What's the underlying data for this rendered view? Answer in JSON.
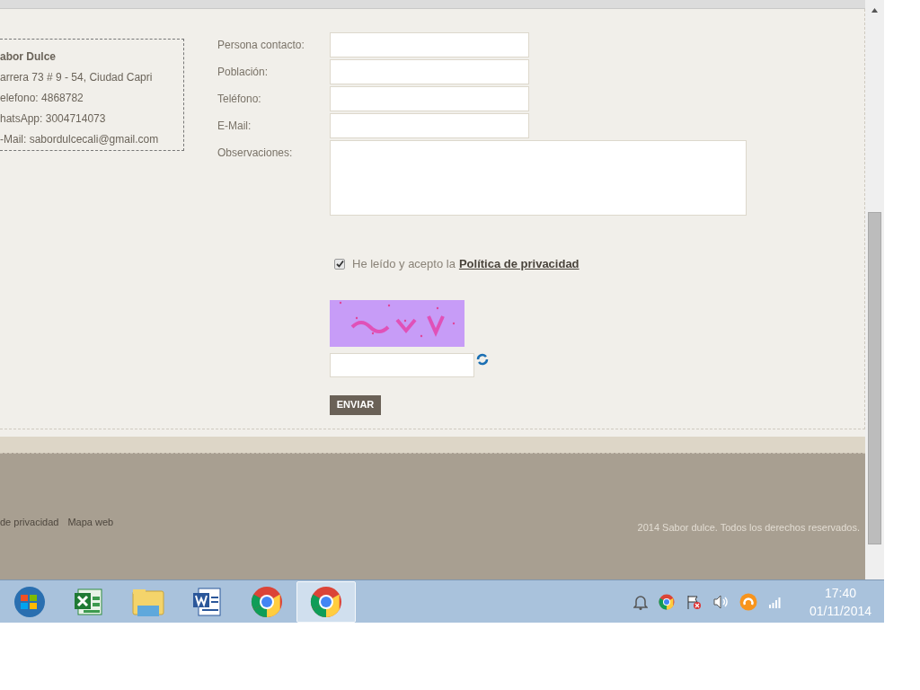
{
  "contact_box": {
    "title": "abor Dulce",
    "lines": [
      "arrera 73 # 9 - 54, Ciudad Capri",
      "elefono: 4868782",
      "hatsApp: 3004714073",
      "-Mail: sabordulcecali@gmail.com"
    ]
  },
  "form": {
    "fields": [
      {
        "label": "Persona contacto:",
        "kind": "input"
      },
      {
        "label": "Población:",
        "kind": "input"
      },
      {
        "label": "Teléfono:",
        "kind": "input"
      },
      {
        "label": "E-Mail:",
        "kind": "input"
      },
      {
        "label": "Observaciones:",
        "kind": "textarea"
      }
    ],
    "consent": {
      "checked": true,
      "text": "He leído y acepto la",
      "link": "Política de privacidad"
    },
    "submit": "ENVIAR"
  },
  "footer": {
    "links": [
      "de privacidad",
      "Mapa web"
    ],
    "copyright": "2014 Sabor dulce. Todos los derechos reservados."
  },
  "taskbar": {
    "apps": [
      {
        "kind": "start",
        "selected": false
      },
      {
        "kind": "excel",
        "selected": false
      },
      {
        "kind": "explorer",
        "selected": false
      },
      {
        "kind": "word",
        "selected": false
      },
      {
        "kind": "chrome",
        "selected": false
      },
      {
        "kind": "chrome",
        "selected": true
      }
    ],
    "time": "17:40",
    "date": "01/11/2014"
  }
}
